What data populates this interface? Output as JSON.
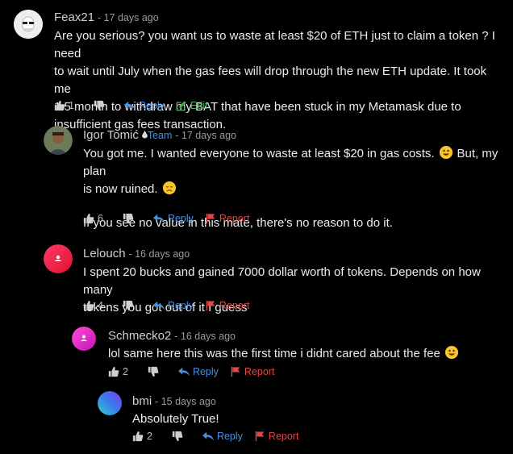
{
  "comments": [
    {
      "author": "Feax21",
      "time": "- 17 days ago",
      "lines": [
        "Are you serious? you want us to waste at least $20 of ETH just to claim a token ? I need",
        "to wait until July when the gas fees will drop through the new ETH update. It took me",
        "1.5 month to withdraw my BAT that have been stuck in my Metamask due to",
        "insufficient gas fees transaction."
      ],
      "likes": "1",
      "reply_label": "Reply",
      "edit_label": "Edit"
    },
    {
      "author": "Igor Tomić",
      "badge": "Team",
      "time": "- 17 days ago",
      "line1": "You got me. I wanted everyone to waste at least $20 in gas costs.",
      "line1b": "But, my plan",
      "line2": "is now ruined.",
      "line3": "If you see no value in this mate, there's no reason to do it.",
      "likes": "6",
      "reply_label": "Reply",
      "report_label": "Report"
    },
    {
      "author": "Lelouch",
      "time": "- 16 days ago",
      "lines": [
        "I spent 20 bucks and gained 7000 dollar worth of tokens. Depends on how many",
        "tokens you got out of it I guess"
      ],
      "likes": "4",
      "reply_label": "Reply",
      "report_label": "Report"
    },
    {
      "author": "Schmecko2",
      "time": "- 16 days ago",
      "line1": "lol same here this was the first time i didnt cared about the fee",
      "likes": "2",
      "reply_label": "Reply",
      "report_label": "Report"
    },
    {
      "author": "bmi",
      "time": "- 15 days ago",
      "line1": "Absolutely True!",
      "likes": "2",
      "reply_label": "Reply",
      "report_label": "Report"
    }
  ],
  "colors": {
    "reply": "#4a90e2",
    "edit": "#3fae52",
    "report": "#e04848"
  }
}
